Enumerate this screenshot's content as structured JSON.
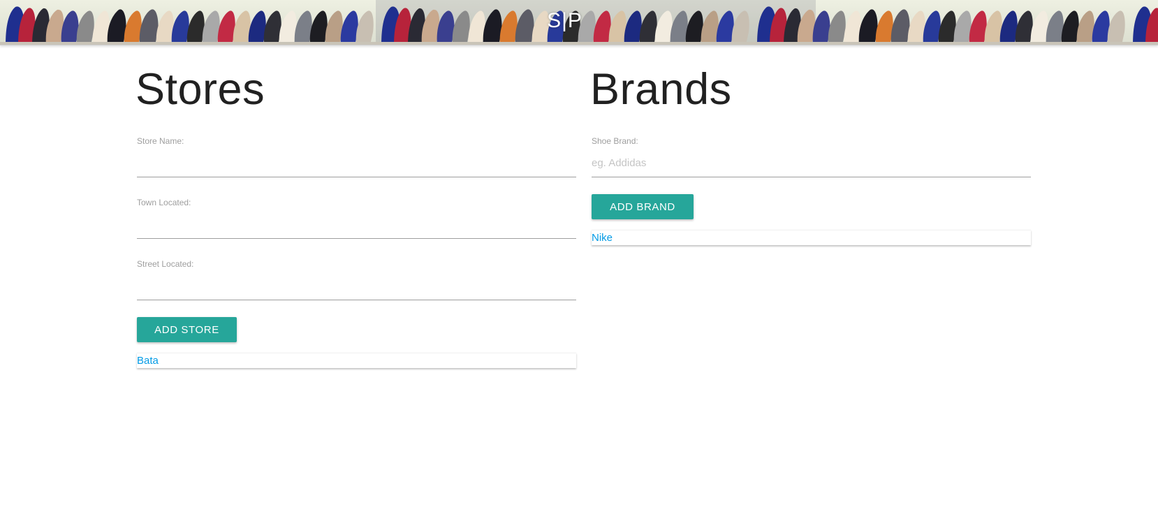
{
  "header": {
    "logo": "S|P"
  },
  "stores": {
    "title": "Stores",
    "fields": [
      {
        "label": "Store Name:",
        "value": "",
        "placeholder": ""
      },
      {
        "label": "Town Located:",
        "value": "",
        "placeholder": ""
      },
      {
        "label": "Street Located:",
        "value": "",
        "placeholder": ""
      }
    ],
    "add_button": "ADD STORE",
    "items": [
      "Bata"
    ]
  },
  "brands": {
    "title": "Brands",
    "fields": [
      {
        "label": "Shoe Brand:",
        "value": "",
        "placeholder": "eg. Addidas"
      }
    ],
    "add_button": "ADD BRAND",
    "items": [
      "Nike"
    ]
  },
  "colors": {
    "accent": "#26a69a",
    "link": "#039be5",
    "label": "#9e9e9e"
  }
}
